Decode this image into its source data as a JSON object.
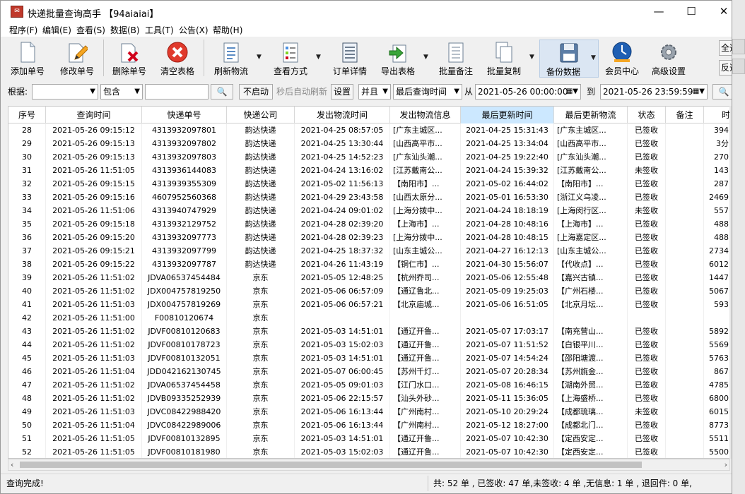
{
  "window": {
    "title": "快递批量查询高手 【94aiaiai】",
    "icon": "app-icon",
    "min": "—",
    "max": "☐",
    "close": "✕"
  },
  "menu": [
    "程序(F)",
    "编辑(E)",
    "查看(S)",
    "数据(B)",
    "工具(T)",
    "公告(X)",
    "帮助(H)"
  ],
  "toolbar": [
    {
      "label": "添加单号",
      "icon": "document-icon"
    },
    {
      "label": "修改单号",
      "icon": "edit-document-icon"
    },
    {
      "label": "删除单号",
      "icon": "delete-document-icon"
    },
    {
      "label": "清空表格",
      "icon": "clear-red-x-icon"
    },
    {
      "label": "刷新物流",
      "icon": "refresh-list-icon"
    },
    {
      "label": "查看方式",
      "icon": "view-mode-icon"
    },
    {
      "label": "订单详情",
      "icon": "order-detail-icon"
    },
    {
      "label": "导出表格",
      "icon": "export-arrow-icon"
    },
    {
      "label": "批量备注",
      "icon": "note-icon"
    },
    {
      "label": "批量复制",
      "icon": "copy-icon"
    },
    {
      "label": "备份数据",
      "icon": "floppy-disk-icon"
    },
    {
      "label": "会员中心",
      "icon": "clock-globe-icon"
    },
    {
      "label": "高级设置",
      "icon": "gear-icon"
    }
  ],
  "side_buttons": [
    "全选",
    "反选"
  ],
  "filter": {
    "label": "根据:",
    "field": "",
    "mode": "包含",
    "search_text": "",
    "auto_refresh_btn": "不启动",
    "auto_refresh_label": "秒后自动刷新",
    "settings_btn": "设置",
    "logic": "并且",
    "time_field": "最后查询时间",
    "from_label": "从",
    "from": "2021-05-26 00:00:00",
    "to_label": "到",
    "to": "2021-05-26 23:59:59"
  },
  "table": {
    "columns": [
      "序号",
      "查询时间",
      "快递单号",
      "快递公司",
      "发出物流时间",
      "发出物流信息",
      "最后更新时间",
      "最后更新物流",
      "状态",
      "备注",
      "时"
    ],
    "rows": [
      [
        "28",
        "2021-05-26 09:15:12",
        "4313932097801",
        "韵达快递",
        "2021-04-25 08:57:05",
        "[广东主城区...",
        "2021-04-25 15:31:43",
        "[广东主城区...",
        "已签收",
        "",
        "394"
      ],
      [
        "29",
        "2021-05-26 09:15:13",
        "4313932097802",
        "韵达快递",
        "2021-04-25 13:30:44",
        "[山西高平市...",
        "2021-04-25 13:34:04",
        "[山西高平市...",
        "已签收",
        "",
        "3分"
      ],
      [
        "30",
        "2021-05-26 09:15:13",
        "4313932097803",
        "韵达快递",
        "2021-04-25 14:52:23",
        "[广东汕头潮...",
        "2021-04-25 19:22:40",
        "[广东汕头潮...",
        "已签收",
        "",
        "270"
      ],
      [
        "31",
        "2021-05-26 11:51:05",
        "4313936144083",
        "韵达快递",
        "2021-04-24 13:16:02",
        "[江苏戴南公...",
        "2021-04-24 15:39:32",
        "[江苏戴南公...",
        "未签收",
        "",
        "143"
      ],
      [
        "32",
        "2021-05-26 09:15:15",
        "4313939355309",
        "韵达快递",
        "2021-05-02 11:56:13",
        "【南阳市】...",
        "2021-05-02 16:44:02",
        "【南阳市】...",
        "已签收",
        "",
        "287"
      ],
      [
        "33",
        "2021-05-26 09:15:16",
        "4607952560368",
        "韵达快递",
        "2021-04-29 23:43:58",
        "[山西太原分...",
        "2021-05-01 16:53:30",
        "[浙江义乌凌...",
        "已签收",
        "",
        "2469"
      ],
      [
        "34",
        "2021-05-26 11:51:06",
        "4313940747929",
        "韵达快递",
        "2021-04-24 09:01:02",
        "[上海分拨中...",
        "2021-04-24 18:18:19",
        "[上海闵行区...",
        "未签收",
        "",
        "557"
      ],
      [
        "35",
        "2021-05-26 09:15:18",
        "4313932129752",
        "韵达快递",
        "2021-04-28 02:39:20",
        "【上海市】...",
        "2021-04-28 10:48:16",
        "【上海市】...",
        "已签收",
        "",
        "488"
      ],
      [
        "36",
        "2021-05-26 09:15:20",
        "4313932097773",
        "韵达快递",
        "2021-04-28 02:39:23",
        "[上海分拨中...",
        "2021-04-28 10:48:15",
        "[上海嘉定区...",
        "已签收",
        "",
        "488"
      ],
      [
        "37",
        "2021-05-26 09:15:21",
        "4313932097799",
        "韵达快递",
        "2021-04-25 18:37:32",
        "[山东主城公...",
        "2021-04-27 16:12:13",
        "[山东主城公...",
        "已签收",
        "",
        "2734"
      ],
      [
        "38",
        "2021-05-26 09:15:22",
        "4313932097787",
        "韵达快递",
        "2021-04-26 11:43:19",
        "【铜仁市】...",
        "2021-04-30 15:56:07",
        "【代收点】...",
        "已签收",
        "",
        "6012"
      ],
      [
        "39",
        "2021-05-26 11:51:02",
        "JDVA06537454484",
        "京东",
        "2021-05-05 12:48:25",
        "【杭州乔司...",
        "2021-05-06 12:55:48",
        "【嘉兴古镇...",
        "已签收",
        "",
        "1447"
      ],
      [
        "40",
        "2021-05-26 11:51:02",
        "JDX004757819250",
        "京东",
        "2021-05-06 06:57:09",
        "【通辽鲁北...",
        "2021-05-09 19:25:03",
        "【广州石楼...",
        "已签收",
        "",
        "5067"
      ],
      [
        "41",
        "2021-05-26 11:51:03",
        "JDX004757819269",
        "京东",
        "2021-05-06 06:57:21",
        "【北京庙城...",
        "2021-05-06 16:51:05",
        "【北京月坛...",
        "已签收",
        "",
        "593"
      ],
      [
        "42",
        "2021-05-26 11:51:00",
        "F00810120674",
        "京东",
        "",
        "",
        "",
        "",
        "",
        "",
        ""
      ],
      [
        "43",
        "2021-05-26 11:51:02",
        "JDVF00810120683",
        "京东",
        "2021-05-03 14:51:01",
        "【通辽开鲁...",
        "2021-05-07 17:03:17",
        "【南充营山...",
        "已签收",
        "",
        "5892"
      ],
      [
        "44",
        "2021-05-26 11:51:02",
        "JDVF00810178723",
        "京东",
        "2021-05-03 15:02:03",
        "【通辽开鲁...",
        "2021-05-07 11:51:52",
        "【白银平川...",
        "已签收",
        "",
        "5569"
      ],
      [
        "45",
        "2021-05-26 11:51:03",
        "JDVF00810132051",
        "京东",
        "2021-05-03 14:51:01",
        "【通辽开鲁...",
        "2021-05-07 14:54:24",
        "【邵阳塘渡...",
        "已签收",
        "",
        "5763"
      ],
      [
        "46",
        "2021-05-26 11:51:04",
        "JDD042162130745",
        "京东",
        "2021-05-07 06:00:45",
        "【苏州千灯...",
        "2021-05-07 20:28:34",
        "【苏州旐金...",
        "已签收",
        "",
        "867"
      ],
      [
        "47",
        "2021-05-26 11:51:02",
        "JDVA06537454458",
        "京东",
        "2021-05-05 09:01:03",
        "【江门水口...",
        "2021-05-08 16:46:15",
        "【湖南外贸...",
        "已签收",
        "",
        "4785"
      ],
      [
        "48",
        "2021-05-26 11:51:02",
        "JDVB09335252939",
        "京东",
        "2021-05-06 22:15:57",
        "【汕头外砂...",
        "2021-05-11 15:36:05",
        "【上海盛桥...",
        "已签收",
        "",
        "6800"
      ],
      [
        "49",
        "2021-05-26 11:51:03",
        "JDVC08422988420",
        "京东",
        "2021-05-06 16:13:44",
        "【广州南村...",
        "2021-05-10 20:29:24",
        "【成都琉璃...",
        "未签收",
        "",
        "6015"
      ],
      [
        "50",
        "2021-05-26 11:51:04",
        "JDVC08422989006",
        "京东",
        "2021-05-06 16:13:44",
        "【广州南村...",
        "2021-05-12 18:27:00",
        "【成都北门...",
        "已签收",
        "",
        "8773"
      ],
      [
        "51",
        "2021-05-26 11:51:05",
        "JDVF00810132895",
        "京东",
        "2021-05-03 14:51:01",
        "【通辽开鲁...",
        "2021-05-07 10:42:30",
        "【定西安定...",
        "已签收",
        "",
        "5511"
      ],
      [
        "52",
        "2021-05-26 11:51:05",
        "JDVF00810181980",
        "京东",
        "2021-05-03 15:02:03",
        "【通辽开鲁...",
        "2021-05-07 10:42:30",
        "【定西安定...",
        "已签收",
        "",
        "5500"
      ]
    ]
  },
  "scroll": {
    "left": "‹",
    "right": "›"
  },
  "status": {
    "left": "查询完成!",
    "right": "共: 52 单 , 已签收:  47 单,未签收:  4 单 ,无信息: 1 单 , 退回件: 0 单,"
  }
}
